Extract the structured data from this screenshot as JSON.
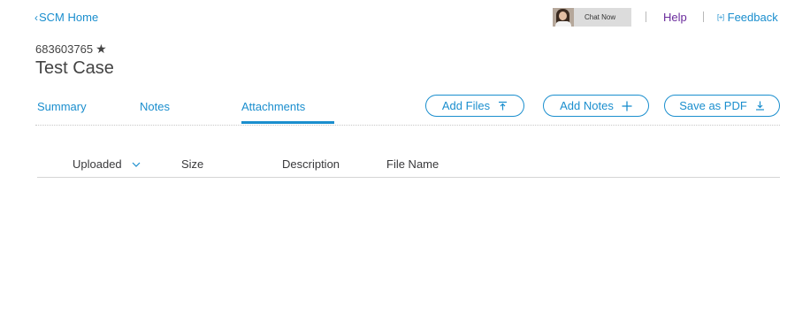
{
  "header": {
    "back_label": "SCM Home",
    "chat_label": "Chat Now",
    "help_label": "Help",
    "feedback_icon": "[+]",
    "feedback_label": "Feedback"
  },
  "case": {
    "id": "683603765",
    "title": "Test Case"
  },
  "tabs": [
    {
      "label": "Summary",
      "active": false
    },
    {
      "label": "Notes",
      "active": false
    },
    {
      "label": "Attachments",
      "active": true
    }
  ],
  "actions": {
    "add_files": "Add Files",
    "add_notes": "Add Notes",
    "save_pdf": "Save as PDF"
  },
  "table": {
    "columns": [
      "Uploaded",
      "Size",
      "Description",
      "File Name"
    ],
    "sorted_by": "Uploaded",
    "rows": []
  },
  "colors": {
    "accent": "#1a8ece",
    "help": "#6a2b9c",
    "text": "#39393b"
  }
}
